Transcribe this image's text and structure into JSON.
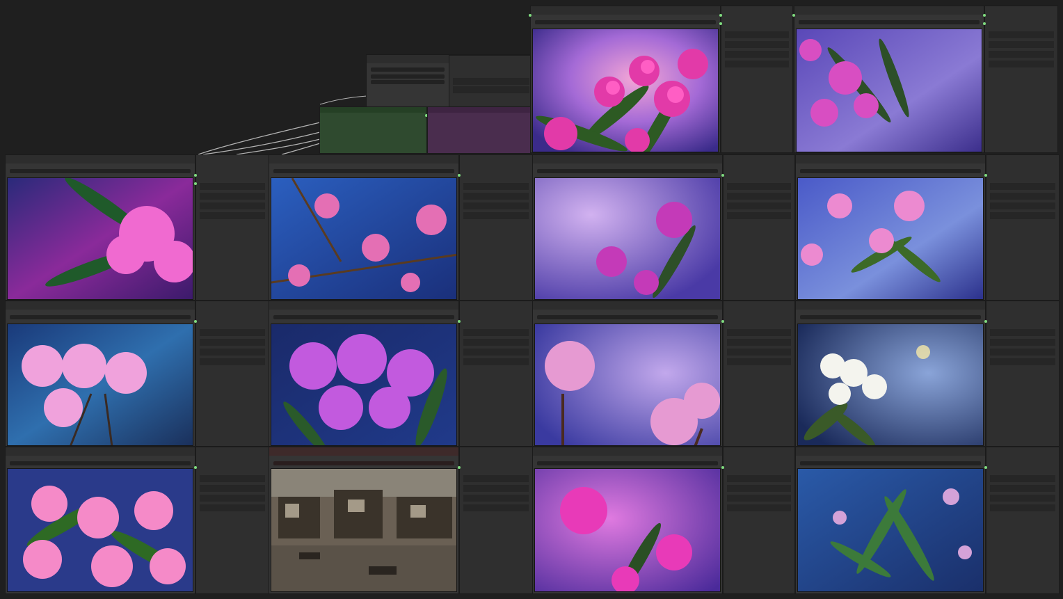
{
  "app": {
    "name": ""
  },
  "colors": {
    "canvas": "#1f1f1f",
    "node_bg": "#353535",
    "group_green": "#2f4a2f",
    "group_purple": "#4a2d4e",
    "pin_green": "#7fdc7f",
    "link": "#b4b4b4"
  },
  "icons": {
    "pin": "dot-icon"
  },
  "nodes": [
    {
      "id": "n1",
      "kind": "save-image",
      "palette": "galaxy-pink",
      "flower": "oleander-magenta"
    },
    {
      "id": "n2",
      "kind": "save-image",
      "palette": "galaxy-violet",
      "flower": "oleander-magenta"
    },
    {
      "id": "n3",
      "kind": "save-image",
      "palette": "galaxy-purple",
      "flower": "oleander-pink-close"
    },
    {
      "id": "n4",
      "kind": "save-image",
      "palette": "galaxy-blue",
      "flower": "oleander-pink-branches"
    },
    {
      "id": "n5",
      "kind": "save-image",
      "palette": "galaxy-lavender",
      "flower": "oleander-magenta-bloom"
    },
    {
      "id": "n6",
      "kind": "save-image",
      "palette": "galaxy-deepblue",
      "flower": "oleander-pink-sprigs"
    },
    {
      "id": "n7",
      "kind": "save-image",
      "palette": "galaxy-teal",
      "flower": "oleander-pink-large"
    },
    {
      "id": "n8",
      "kind": "save-image",
      "palette": "galaxy-navy",
      "flower": "oleander-violet-cluster"
    },
    {
      "id": "n9",
      "kind": "save-image",
      "palette": "galaxy-periwinkle",
      "flower": "oleander-pink-soft"
    },
    {
      "id": "n10",
      "kind": "save-image",
      "palette": "galaxy-night",
      "flower": "oleander-white"
    },
    {
      "id": "n11",
      "kind": "save-image",
      "palette": "galaxy-indigo",
      "flower": "oleander-pink-dense"
    },
    {
      "id": "n12",
      "kind": "save-image",
      "palette": "oil-street",
      "flower": "impasto-street-scene"
    },
    {
      "id": "n13",
      "kind": "save-image",
      "palette": "galaxy-magenta",
      "flower": "oleander-magenta-sprig"
    },
    {
      "id": "n14",
      "kind": "save-image",
      "palette": "galaxy-sky",
      "flower": "oleander-green-leaves"
    }
  ]
}
